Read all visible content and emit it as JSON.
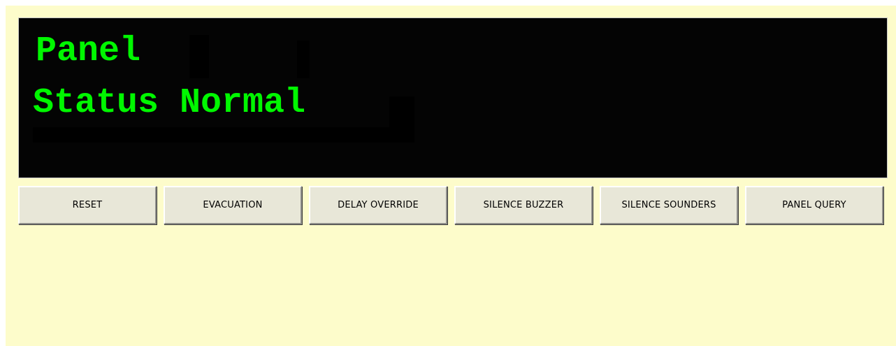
{
  "display": {
    "line1": "Panel",
    "line2": "Status Normal",
    "text_color": "#00f700",
    "background_color": "#040404"
  },
  "buttons": [
    {
      "label": "RESET"
    },
    {
      "label": "EVACUATION"
    },
    {
      "label": "DELAY OVERRIDE"
    },
    {
      "label": "SILENCE BUZZER"
    },
    {
      "label": "SILENCE SOUNDERS"
    },
    {
      "label": "PANEL QUERY"
    }
  ],
  "colors": {
    "panel_background": "#fdfccb",
    "button_face": "#e8e7d8"
  }
}
